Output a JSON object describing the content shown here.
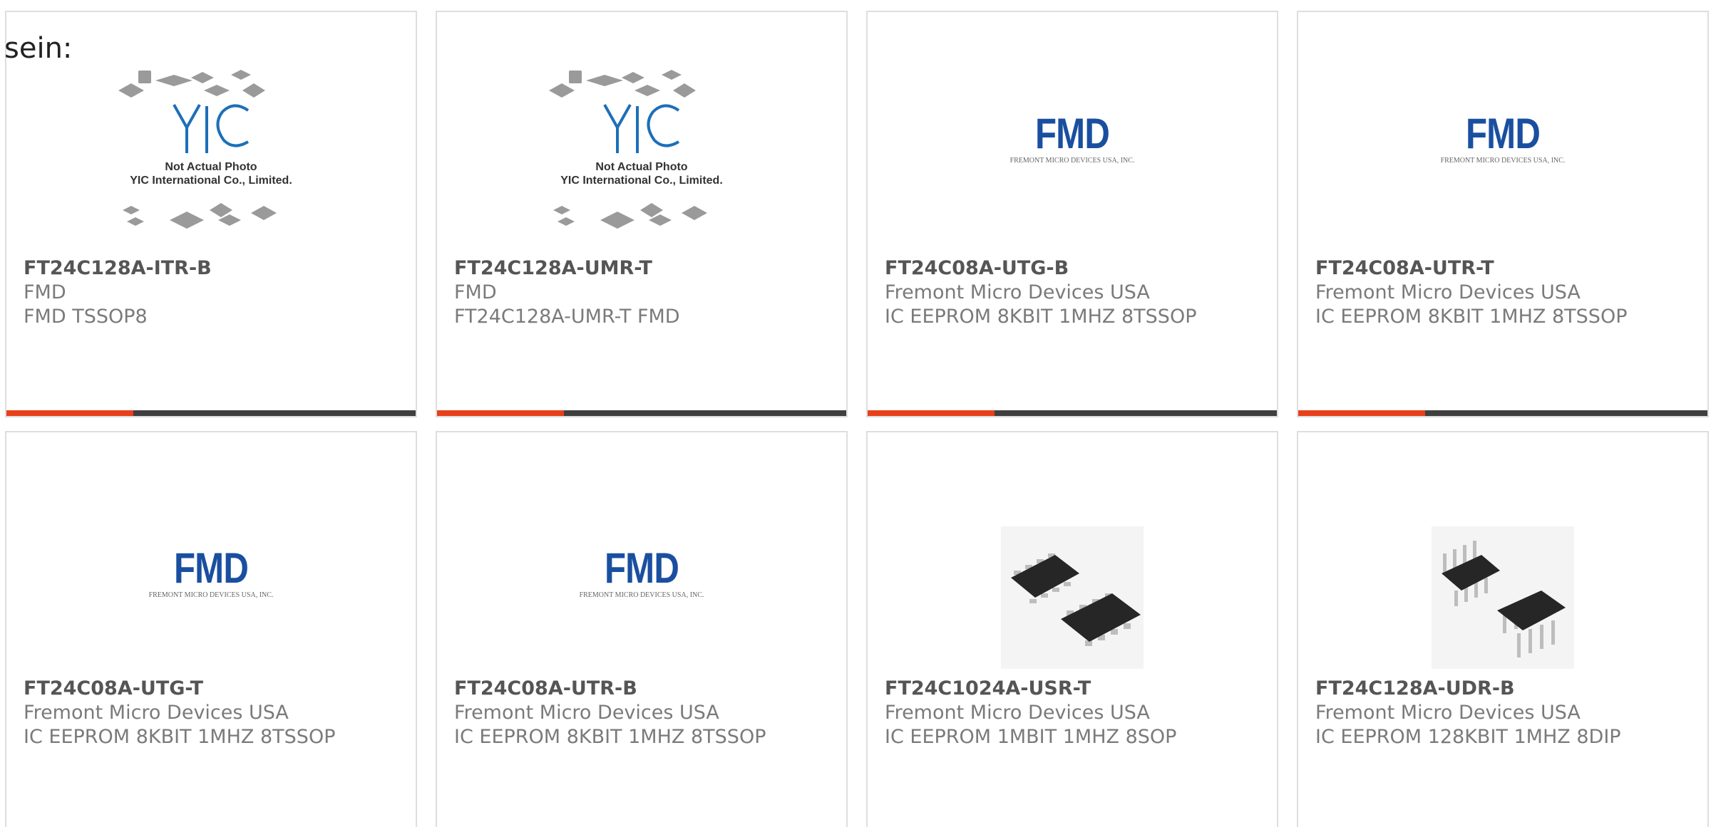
{
  "intro_text": "sein:",
  "colors": {
    "progress_fill": "#e8401a",
    "progress_track": "#3f3f3f",
    "fmd_blue": "#1a4fa0",
    "card_border": "#dedede"
  },
  "products": [
    {
      "part": "FT24C128A-ITR-B",
      "maker": "FMD",
      "desc": "FMD TSSOP8",
      "image": "yic-placeholder",
      "image_caption_1": "Not Actual Photo",
      "image_caption_2": "YIC International Co., Limited.",
      "image_logo": "YIC"
    },
    {
      "part": "FT24C128A-UMR-T",
      "maker": "FMD",
      "desc": "FT24C128A-UMR-T FMD",
      "image": "yic-placeholder",
      "image_caption_1": "Not Actual Photo",
      "image_caption_2": "YIC International Co., Limited.",
      "image_logo": "YIC"
    },
    {
      "part": "FT24C08A-UTG-B",
      "maker": "Fremont Micro Devices USA",
      "desc": "IC EEPROM 8KBIT 1MHZ 8TSSOP",
      "image": "fmd-logo",
      "image_logo": "FMD",
      "image_subtext": "FREMONT MICRO DEVICES USA, INC."
    },
    {
      "part": "FT24C08A-UTR-T",
      "maker": "Fremont Micro Devices USA",
      "desc": "IC EEPROM 8KBIT 1MHZ 8TSSOP",
      "image": "fmd-logo",
      "image_logo": "FMD",
      "image_subtext": "FREMONT MICRO DEVICES USA, INC."
    },
    {
      "part": "FT24C08A-UTG-T",
      "maker": "Fremont Micro Devices USA",
      "desc": "IC EEPROM 8KBIT 1MHZ 8TSSOP",
      "image": "fmd-logo",
      "image_logo": "FMD",
      "image_subtext": "FREMONT MICRO DEVICES USA, INC."
    },
    {
      "part": "FT24C08A-UTR-B",
      "maker": "Fremont Micro Devices USA",
      "desc": "IC EEPROM 8KBIT 1MHZ 8TSSOP",
      "image": "fmd-logo",
      "image_logo": "FMD",
      "image_subtext": "FREMONT MICRO DEVICES USA, INC."
    },
    {
      "part": "FT24C1024A-USR-T",
      "maker": "Fremont Micro Devices USA",
      "desc": "IC EEPROM 1MBIT 1MHZ 8SOP",
      "image": "soic8-chip-photo"
    },
    {
      "part": "FT24C128A-UDR-B",
      "maker": "Fremont Micro Devices USA",
      "desc": "IC EEPROM 128KBIT 1MHZ 8DIP",
      "image": "dip8-chip-photo"
    }
  ],
  "progress_fraction": 0.31
}
